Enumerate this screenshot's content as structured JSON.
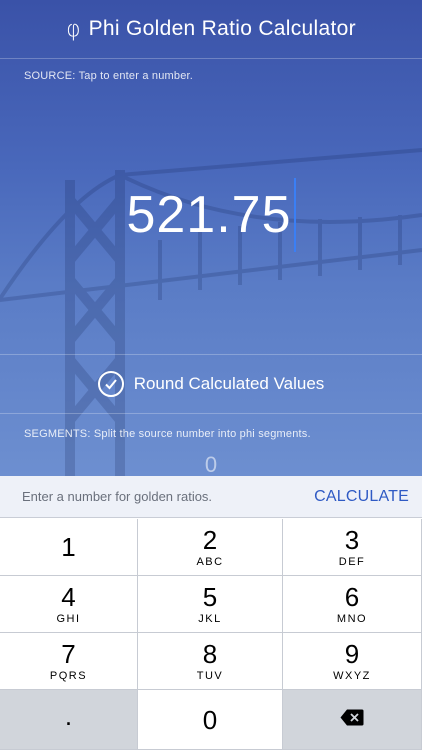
{
  "header": {
    "icon": "phi-icon",
    "title": "Phi Golden Ratio Calculator"
  },
  "source": {
    "label": "SOURCE: Tap to enter a number.",
    "value": "521.75"
  },
  "round": {
    "label": "Round Calculated Values",
    "checked": true
  },
  "segments": {
    "label": "SEGMENTS: Split the source number into phi segments.",
    "value": "0"
  },
  "input_bar": {
    "placeholder": "Enter a number for golden ratios.",
    "calculate_label": "CALCULATE"
  },
  "keypad": {
    "keys": [
      {
        "digit": "1",
        "letters": ""
      },
      {
        "digit": "2",
        "letters": "ABC"
      },
      {
        "digit": "3",
        "letters": "DEF"
      },
      {
        "digit": "4",
        "letters": "GHI"
      },
      {
        "digit": "5",
        "letters": "JKL"
      },
      {
        "digit": "6",
        "letters": "MNO"
      },
      {
        "digit": "7",
        "letters": "PQRS"
      },
      {
        "digit": "8",
        "letters": "TUV"
      },
      {
        "digit": "9",
        "letters": "WXYZ"
      },
      {
        "digit": "0",
        "letters": ""
      }
    ],
    "decimal": ".",
    "delete_icon": "backspace-icon"
  },
  "colors": {
    "accent": "#2f5ac4",
    "background_top": "#3a52a8",
    "background_bottom": "#6d8fd0",
    "cursor": "#3a7ff5"
  }
}
